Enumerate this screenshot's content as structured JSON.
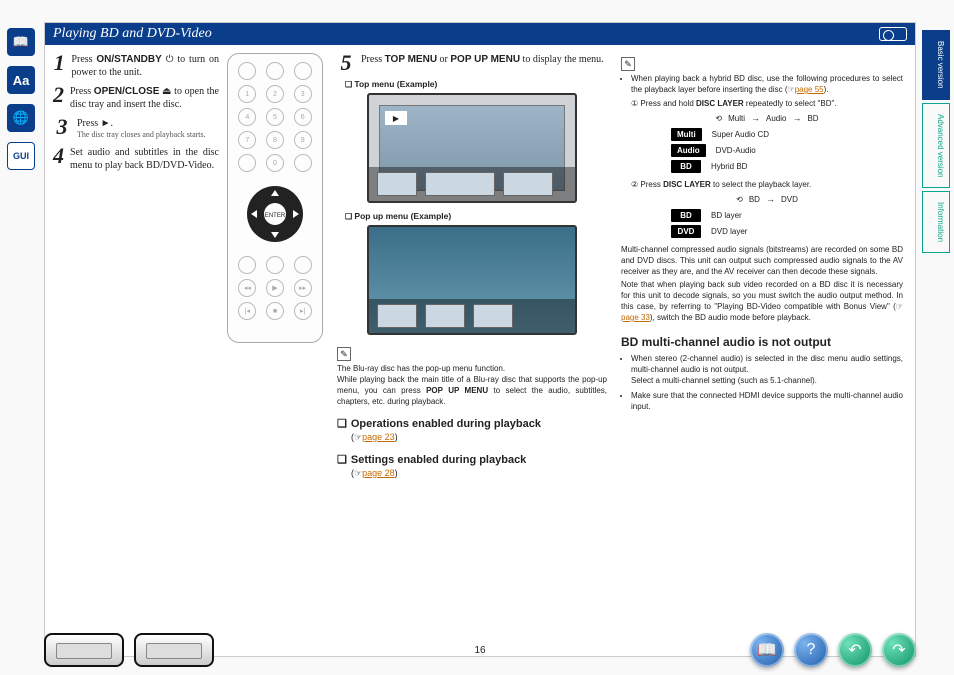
{
  "title": "Playing BD and DVD-Video",
  "page_number": "16",
  "side_tabs": [
    "Basic version",
    "Advanced version",
    "Information"
  ],
  "steps": [
    {
      "n": "1",
      "html": "Press <b>ON/STANDBY</b> ⏻ to turn on power to the unit."
    },
    {
      "n": "2",
      "html": "Press <b>OPEN/CLOSE</b> ⏏ to open the disc tray and insert the disc."
    },
    {
      "n": "3",
      "html": "Press ►.",
      "sub": "The disc tray closes and playback starts."
    },
    {
      "n": "4",
      "html": "Set audio and subtitles in the disc menu to play back BD/DVD-Video."
    }
  ],
  "step5": {
    "n": "5",
    "html": "Press <b>TOP MENU</b> or <b>POP UP MENU</b> to display the menu."
  },
  "eg_top_label": "Top menu (Example)",
  "eg_pop_label": "Pop up menu (Example)",
  "popup_note": "The Blu-ray disc has the pop-up menu function.\nWhile playing back the main title of a Blu-ray disc that supports the pop-up menu, you can press POP UP MENU to select the audio, subtitles, chapters, etc. during playback.",
  "ops_head": "Operations enabled during playback",
  "ops_ref": "page 23",
  "set_head": "Settings enabled during playback",
  "set_ref": "page 28",
  "col3_bullet1": "When playing back a hybrid BD disc, use the following procedures to select the playback layer before inserting the disc (",
  "col3_bullet1_link": "page 55",
  "col3_bullet1_end": ").",
  "circle1": "① Press and hold DISC LAYER repeatedly to select \"BD\".",
  "cycle1": [
    "Multi",
    "Audio",
    "BD"
  ],
  "pill_rows1": [
    {
      "pill": "Multi",
      "text": "Super Audio CD"
    },
    {
      "pill": "Audio",
      "text": "DVD-Audio"
    },
    {
      "pill": "BD",
      "text": "Hybrid BD"
    }
  ],
  "circle2": "② Press DISC LAYER to select the playback layer.",
  "cycle2": [
    "BD",
    "DVD"
  ],
  "pill_rows2": [
    {
      "pill": "BD",
      "text": "BD layer"
    },
    {
      "pill": "DVD",
      "text": "DVD layer"
    }
  ],
  "para1": "Multi-channel compressed audio signals (bitstreams) are recorded on some BD and DVD discs. This unit can output such compressed audio signals to the AV receiver as they are, and the AV receiver can then decode these signals.",
  "para2a": "Note that when playing back sub video recorded on a BD disc it is necessary for this unit to decode signals, so you must switch the audio output method. In this case, by referring to \"Playing BD-Video compatible with Bonus View\" (",
  "para2_link": "page 33",
  "para2b": "), switch the BD audio mode before playback.",
  "h3": "BD multi-channel audio is not output",
  "bul2": [
    "When stereo (2-channel audio) is selected in the disc menu audio settings, multi-channel audio is not output.\nSelect a multi-channel setting (such as 5.1-channel).",
    "Make sure that the connected HDMI device supports the multi-channel audio input."
  ]
}
